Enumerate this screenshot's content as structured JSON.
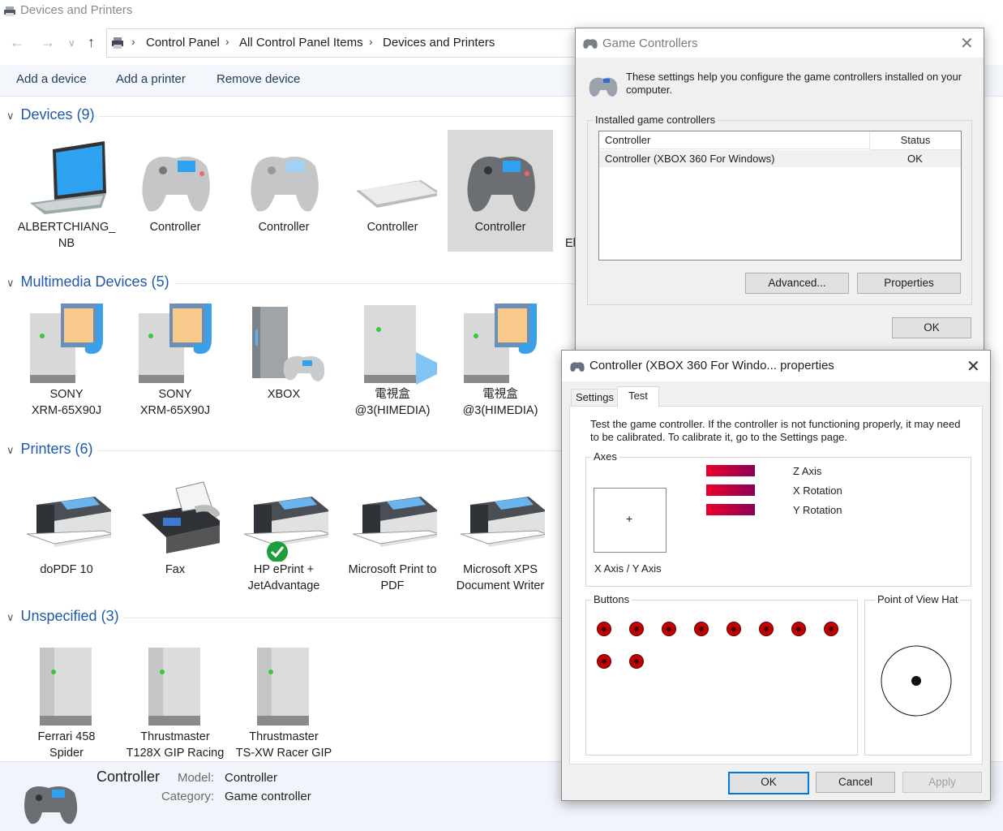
{
  "window": {
    "title": "Devices and Printers"
  },
  "address": {
    "crumbs": [
      "Control Panel",
      "All Control Panel Items",
      "Devices and Printers"
    ]
  },
  "commands": {
    "add_device": "Add a device",
    "add_printer": "Add a printer",
    "remove_device": "Remove device"
  },
  "groups": {
    "devices": {
      "label": "Devices",
      "count": "(9)",
      "items": [
        {
          "line1": "ALBERTCHIANG_",
          "line2": "NB"
        },
        {
          "line1": "Controller",
          "line2": ""
        },
        {
          "line1": "Controller",
          "line2": ""
        },
        {
          "line1": "Controller",
          "line2": ""
        },
        {
          "line1": "Controller",
          "line2": ""
        },
        {
          "line1": "El",
          "line2": ""
        }
      ]
    },
    "multimedia": {
      "label": "Multimedia Devices",
      "count": "(5)",
      "items": [
        {
          "line1": "SONY",
          "line2": "XRM-65X90J"
        },
        {
          "line1": "SONY",
          "line2": "XRM-65X90J"
        },
        {
          "line1": "XBOX",
          "line2": ""
        },
        {
          "line1": "電視盒",
          "line2": "@3(HIMEDIA)"
        },
        {
          "line1": "電視盒",
          "line2": "@3(HIMEDIA)"
        }
      ]
    },
    "printers": {
      "label": "Printers",
      "count": "(6)",
      "items": [
        {
          "line1": "doPDF 10",
          "line2": ""
        },
        {
          "line1": "Fax",
          "line2": ""
        },
        {
          "line1": "HP ePrint +",
          "line2": "JetAdvantage"
        },
        {
          "line1": "Microsoft Print to",
          "line2": "PDF"
        },
        {
          "line1": "Microsoft XPS",
          "line2": "Document Writer"
        }
      ]
    },
    "unspecified": {
      "label": "Unspecified",
      "count": "(3)",
      "items": [
        {
          "line1": "Ferrari 458",
          "line2": "Spider"
        },
        {
          "line1": "Thrustmaster",
          "line2": "T128X GIP Racing"
        },
        {
          "line1": "Thrustmaster",
          "line2": "TS-XW Racer GIP"
        }
      ]
    }
  },
  "details": {
    "name": "Controller",
    "model_label": "Model:",
    "model_value": "Controller",
    "category_label": "Category:",
    "category_value": "Game controller"
  },
  "game_controllers": {
    "title": "Game Controllers",
    "description": "These settings help you configure the game controllers installed on your computer.",
    "installed_label": "Installed game controllers",
    "col_controller": "Controller",
    "col_status": "Status",
    "row_name": "Controller (XBOX 360 For Windows)",
    "row_status": "OK",
    "advanced": "Advanced...",
    "properties": "Properties",
    "ok": "OK"
  },
  "props": {
    "title": "Controller (XBOX 360 For Windo... properties",
    "tab_settings": "Settings",
    "tab_test": "Test",
    "instructions": "Test the game controller.  If the controller is not functioning properly, it may need to be calibrated.  To calibrate it, go to the Settings page.",
    "axes_label": "Axes",
    "crosshair": "+",
    "xy_label": "X Axis / Y Axis",
    "z_axis": "Z Axis",
    "x_rotation": "X Rotation",
    "y_rotation": "Y Rotation",
    "buttons_label": "Buttons",
    "pov_label": "Point of View Hat",
    "ok": "OK",
    "cancel": "Cancel",
    "apply": "Apply"
  }
}
